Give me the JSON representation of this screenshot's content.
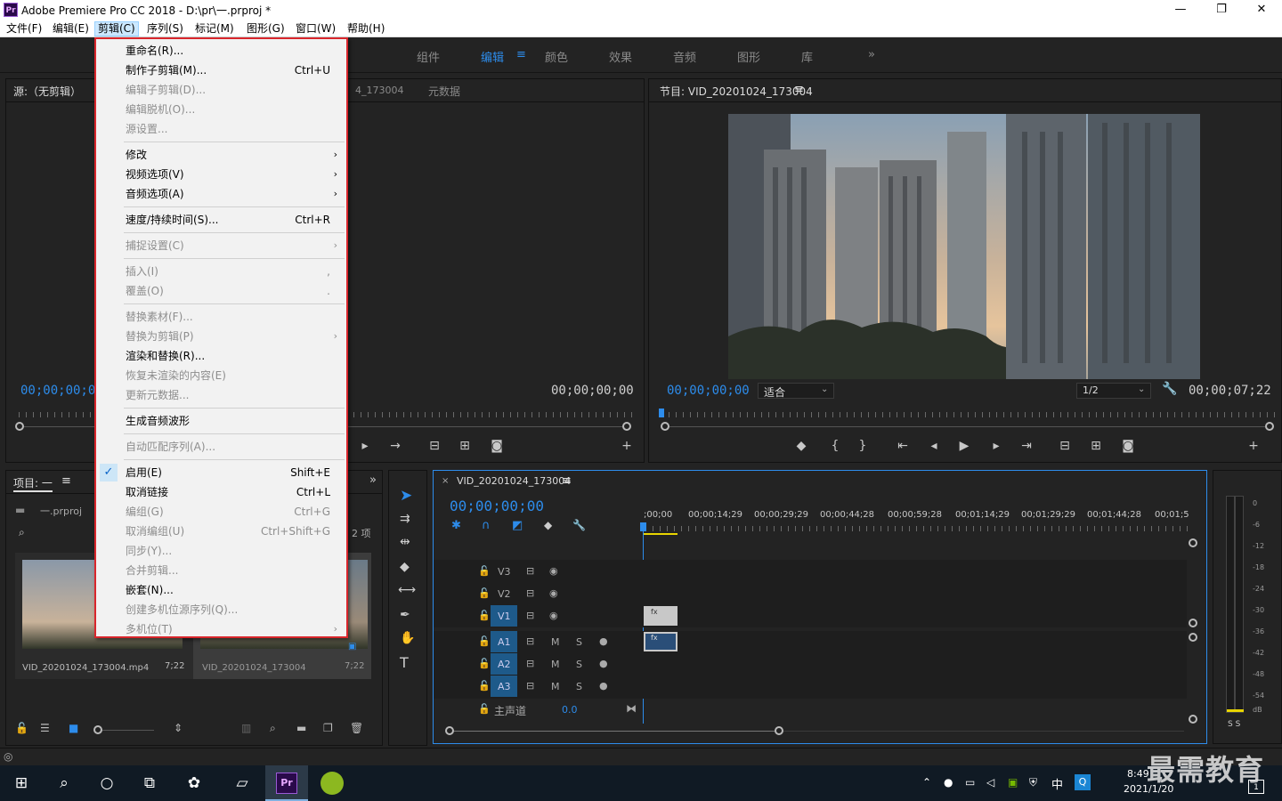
{
  "window": {
    "app_icon": "Pr",
    "title": "Adobe Premiere Pro CC 2018 - D:\\pr\\一.prproj *",
    "minimize": "—",
    "maximize": "❐",
    "close": "✕"
  },
  "menubar": [
    {
      "label": "文件(F)"
    },
    {
      "label": "编辑(E)"
    },
    {
      "label": "剪辑(C)"
    },
    {
      "label": "序列(S)"
    },
    {
      "label": "标记(M)"
    },
    {
      "label": "图形(G)"
    },
    {
      "label": "窗口(W)"
    },
    {
      "label": "帮助(H)"
    }
  ],
  "workspaces": {
    "tabs": [
      "组件",
      "编辑",
      "颜色",
      "效果",
      "音频",
      "图形",
      "库"
    ],
    "active": "编辑",
    "menu_glyph": "≡",
    "more": "»"
  },
  "source_panel": {
    "title": "源:（无剪辑）",
    "menu_glyph": "≡",
    "tab_partial": "4_173004",
    "tab_metadata": "元数据",
    "timecode_left": "00;00;00;00",
    "timecode_right": "00;00;00;00"
  },
  "program_panel": {
    "title": "节目: VID_20201024_173004",
    "menu_glyph": "≡",
    "timecode_left": "00;00;00;00",
    "fit_label": "适合",
    "resolution": "1/2",
    "timecode_right": "00;00;07;22"
  },
  "project_panel": {
    "title": "项目: 一",
    "menu_glyph": "≡",
    "file_name": "一.prproj",
    "items_count": "2 项",
    "clips": [
      {
        "name": "VID_20201024_173004.mp4",
        "duration": "7;22"
      },
      {
        "name": "VID_20201024_173004",
        "duration": "7;22"
      }
    ]
  },
  "timeline": {
    "close_x": "×",
    "sequence_name": "VID_20201024_173004",
    "menu_glyph": "≡",
    "timecode": "00;00;00;00",
    "ruler_labels": [
      ";00;00",
      "00;00;14;29",
      "00;00;29;29",
      "00;00;44;28",
      "00;00;59;28",
      "00;01;14;29",
      "00;01;29;29",
      "00;01;44;28",
      "00;01;5"
    ],
    "video_tracks": [
      "V3",
      "V2",
      "V1"
    ],
    "audio_tracks": [
      "A1",
      "A2",
      "A3"
    ],
    "master_label": "主声道",
    "master_value": "0.0",
    "m_label": "M",
    "s_label": "S",
    "clip_fx": "fx"
  },
  "meter": {
    "ticks": [
      "0",
      "-6",
      "-12",
      "-18",
      "-24",
      "-30",
      "-36",
      "-42",
      "-48",
      "-54",
      "dB"
    ],
    "solo": "S S"
  },
  "dropdown": {
    "items": [
      {
        "label": "重命名(R)...",
        "shortcut": "",
        "enabled": true
      },
      {
        "label": "制作子剪辑(M)...",
        "shortcut": "Ctrl+U",
        "enabled": true
      },
      {
        "label": "编辑子剪辑(D)...",
        "shortcut": "",
        "enabled": false
      },
      {
        "label": "编辑脱机(O)...",
        "shortcut": "",
        "enabled": false
      },
      {
        "label": "源设置...",
        "shortcut": "",
        "enabled": false
      },
      {
        "label": "修改",
        "shortcut": "",
        "enabled": true,
        "submenu": true
      },
      {
        "label": "视频选项(V)",
        "shortcut": "",
        "enabled": true,
        "submenu": true
      },
      {
        "label": "音频选项(A)",
        "shortcut": "",
        "enabled": true,
        "submenu": true
      },
      {
        "label": "速度/持续时间(S)...",
        "shortcut": "Ctrl+R",
        "enabled": true
      },
      {
        "label": "捕捉设置(C)",
        "shortcut": "",
        "enabled": false,
        "submenu": true
      },
      {
        "label": "插入(I)",
        "shortcut": ",",
        "enabled": false
      },
      {
        "label": "覆盖(O)",
        "shortcut": ".",
        "enabled": false
      },
      {
        "label": "替换素材(F)...",
        "shortcut": "",
        "enabled": false
      },
      {
        "label": "替换为剪辑(P)",
        "shortcut": "",
        "enabled": false,
        "submenu": true
      },
      {
        "label": "渲染和替换(R)...",
        "shortcut": "",
        "enabled": true
      },
      {
        "label": "恢复未渲染的内容(E)",
        "shortcut": "",
        "enabled": false
      },
      {
        "label": "更新元数据...",
        "shortcut": "",
        "enabled": false
      },
      {
        "label": "生成音频波形",
        "shortcut": "",
        "enabled": true
      },
      {
        "label": "自动匹配序列(A)...",
        "shortcut": "",
        "enabled": false
      },
      {
        "label": "启用(E)",
        "shortcut": "Shift+E",
        "enabled": true,
        "checked": true
      },
      {
        "label": "取消链接",
        "shortcut": "Ctrl+L",
        "enabled": true
      },
      {
        "label": "编组(G)",
        "shortcut": "Ctrl+G",
        "enabled": false
      },
      {
        "label": "取消编组(U)",
        "shortcut": "Ctrl+Shift+G",
        "enabled": false
      },
      {
        "label": "同步(Y)...",
        "shortcut": "",
        "enabled": false
      },
      {
        "label": "合并剪辑...",
        "shortcut": "",
        "enabled": false
      },
      {
        "label": "嵌套(N)...",
        "shortcut": "",
        "enabled": true
      },
      {
        "label": "创建多机位源序列(Q)...",
        "shortcut": "",
        "enabled": false
      },
      {
        "label": "多机位(T)",
        "shortcut": "",
        "enabled": false,
        "submenu": true
      }
    ],
    "check_glyph": "✓",
    "submenu_glyph": "›"
  },
  "taskbar": {
    "ime": "中",
    "time": "8:49",
    "date": "2021/1/20",
    "notification_count": "1"
  },
  "watermark": "最需教育",
  "colors": {
    "accent_blue": "#2d8ceb",
    "menu_border_red": "#d9262c",
    "track_blue": "#1e5a8a"
  }
}
